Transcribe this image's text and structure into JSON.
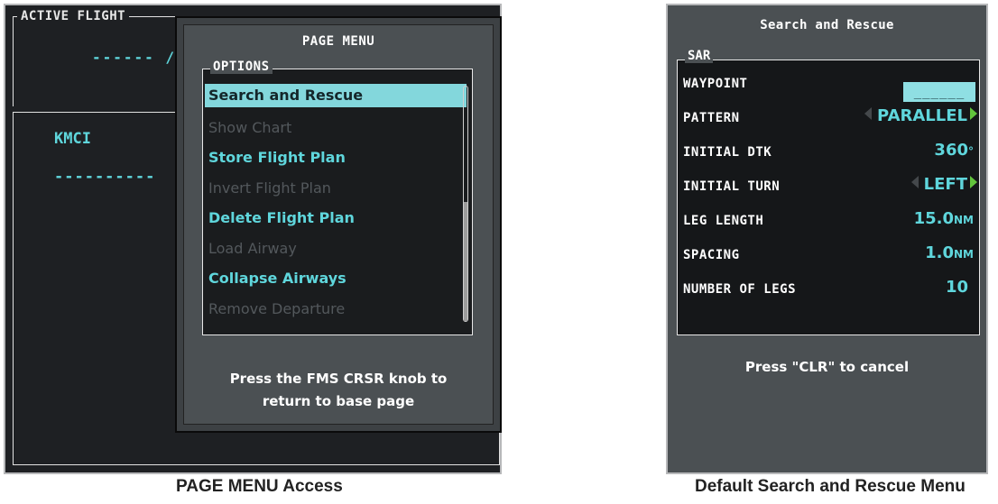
{
  "left_screen": {
    "flight_plan": {
      "header_label": "ACTIVE FLIGHT",
      "route_dashes": "------ /",
      "waypoint": "KMCI",
      "waypoint_dashes": "----------"
    },
    "page_menu": {
      "title": "PAGE MENU",
      "options_label": "OPTIONS",
      "options": [
        {
          "label": "Search and Rescue",
          "state": "selected"
        },
        {
          "label": "Show Chart",
          "state": "disabled"
        },
        {
          "label": "Store Flight Plan",
          "state": "enabled"
        },
        {
          "label": "Invert Flight Plan",
          "state": "disabled"
        },
        {
          "label": "Delete Flight Plan",
          "state": "enabled"
        },
        {
          "label": "Load Airway",
          "state": "disabled"
        },
        {
          "label": "Collapse Airways",
          "state": "enabled"
        },
        {
          "label": "Remove Departure",
          "state": "disabled"
        }
      ],
      "help_line1": "Press the FMS CRSR knob to",
      "help_line2": "return to base page"
    },
    "caption": "PAGE MENU Access"
  },
  "right_screen": {
    "title": "Search and Rescue",
    "group_label": "SAR",
    "fields": {
      "waypoint": {
        "label": "WAYPOINT",
        "value": "______"
      },
      "pattern": {
        "label": "PATTERN",
        "value": "PARALLEL"
      },
      "initial_dtk": {
        "label": "INITIAL DTK",
        "value": "360",
        "unit": "°"
      },
      "initial_turn": {
        "label": "INITIAL TURN",
        "value": "LEFT"
      },
      "leg_length": {
        "label": "LEG LENGTH",
        "value": "15.0",
        "unit": "NM"
      },
      "spacing": {
        "label": "SPACING",
        "value": "1.0",
        "unit": "NM"
      },
      "number_of_legs": {
        "label": "NUMBER OF LEGS",
        "value": "10"
      }
    },
    "help": "Press \"CLR\" to cancel",
    "caption": "Default Search and Rescue Menu"
  },
  "colors": {
    "bezel": "#4b5053",
    "screen_bg": "#1e2023",
    "cyan_text": "#5fd6dc",
    "selection": "#83d7dc",
    "disabled_text": "#53585c",
    "arrow_green": "#63c53c"
  }
}
